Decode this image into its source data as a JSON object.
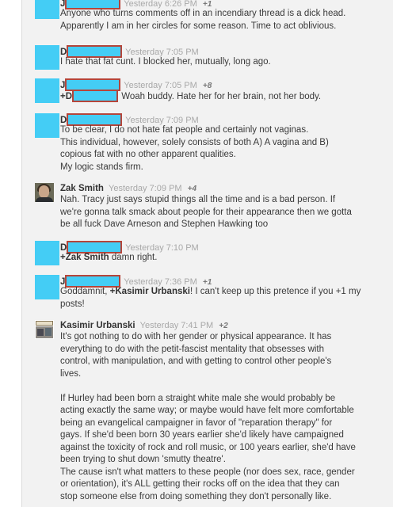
{
  "comments": [
    {
      "initial": "J",
      "time": "Yesterday 6:26 PM",
      "plus": "+1",
      "lines": [
        "Anyone who turns comments off in an incendiary thread is a dick head.",
        "Apparently I am in her circles for some reason. Time to act oblivious."
      ]
    },
    {
      "initial": "D",
      "time": "Yesterday 7:05 PM",
      "lines": [
        "I hate that fat cunt. I blocked her, mutually, long ago."
      ]
    },
    {
      "initial": "J",
      "time": "Yesterday 7:05 PM",
      "plus": "+8",
      "mention_prefix": "+D",
      "mention_rest": " Woah buddy. Hate her for her brain, not her body."
    },
    {
      "initial": "D",
      "time": "Yesterday 7:09 PM",
      "lines": [
        "To be clear, I do not hate fat people and certainly not vaginas.",
        "This individual, however, solely consists of both A) A vagina and B)",
        "copious fat with no other apparent qualities.",
        "My logic stands firm."
      ]
    },
    {
      "name": "Zak Smith",
      "time": "Yesterday 7:09 PM",
      "plus": "+4",
      "lines": [
        "Nah. Tracy just says stupid things all the time and is a bad person. If",
        "we're gonna talk smack about people for their appearance then we gotta",
        "be all fuck Dave Arneson and Stephen Hawking too"
      ]
    },
    {
      "initial": "D",
      "time": "Yesterday 7:10 PM",
      "mention": "+Zak Smith",
      "mention_rest": " damn right."
    },
    {
      "initial": "J",
      "time": "Yesterday 7:36 PM",
      "plus": "+1",
      "pre": "Goddamnit, ",
      "mention": "+Kasimir Urbanski",
      "mention_rest": "! I can't keep up this pretence if you +1 my",
      "line2": "posts!"
    },
    {
      "name": "Kasimir Urbanski",
      "time": "Yesterday 7:41 PM",
      "plus": "+2",
      "para1": [
        "It's got nothing to do with her gender or physical appearance. It has",
        "everything to do with the petit-fascist mentality that obsesses with",
        "control, with manipulation, and with getting to control other people's",
        "lives."
      ],
      "para2": [
        "If Hurley had been born a straight white male she would probably be",
        "acting exactly the same way; or maybe would have felt more comfortable",
        "being an evangelical campaigner in favor of \"reparation therapy\" for",
        "gays.  If she'd been born 30 years earlier she'd likely have campaigned",
        "against the toxicity of rock and roll music, or 100 years earlier, she'd have",
        "been trying to shut down 'smutty theatre'.",
        "The cause isn't what matters to these people (nor does sex, race, gender",
        "or orientation), it's ALL getting their rocks off on the idea that they can",
        "stop someone else from doing something they don't personally like."
      ]
    }
  ],
  "colors": {
    "redaction_fill": "#44cdf5",
    "redaction_border": "#b5453a",
    "timestamp": "#a8a8a8"
  }
}
